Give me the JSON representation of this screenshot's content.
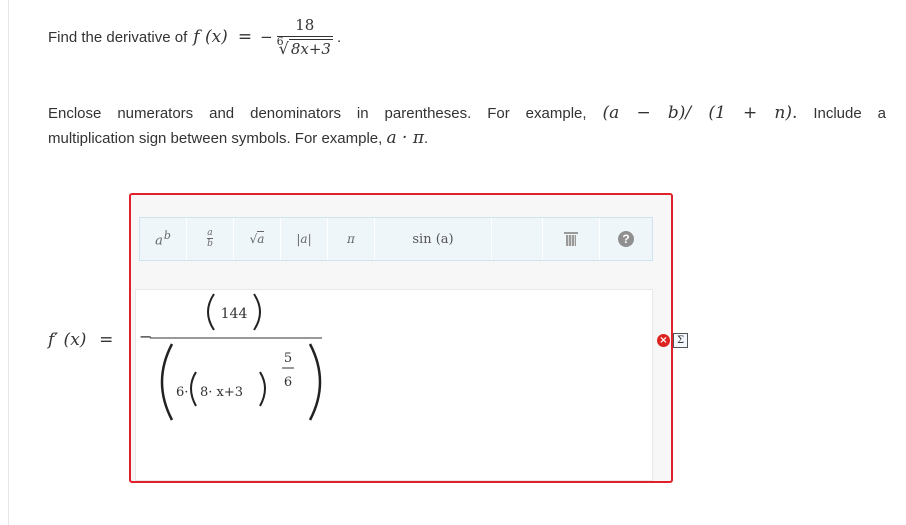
{
  "question": {
    "prefix": "Find the derivative of",
    "function": "f (x)",
    "equals": "=",
    "minus": "−",
    "numerator": "18",
    "root_index": "6",
    "radicand": "8x+3",
    "end": "."
  },
  "instructions": {
    "part1": "Enclose numerators and denominators in parentheses. For example,",
    "example1": "(a − b)/ (1 + n).",
    "part2": "Include a",
    "part3": "multiplication sign between symbols. For example,",
    "example2": "a · π",
    "end": "."
  },
  "answer_label": "f′ (x)",
  "answer_equals": "=",
  "toolbar": {
    "sin_label": "sin (a)"
  },
  "expression": {
    "minus": "−",
    "numerator": "144",
    "coef": "6·",
    "inner": "8· x+3",
    "exp_num": "5",
    "exp_den": "6"
  },
  "status": {
    "error_glyph": "×",
    "sigma_glyph": "Σ"
  }
}
